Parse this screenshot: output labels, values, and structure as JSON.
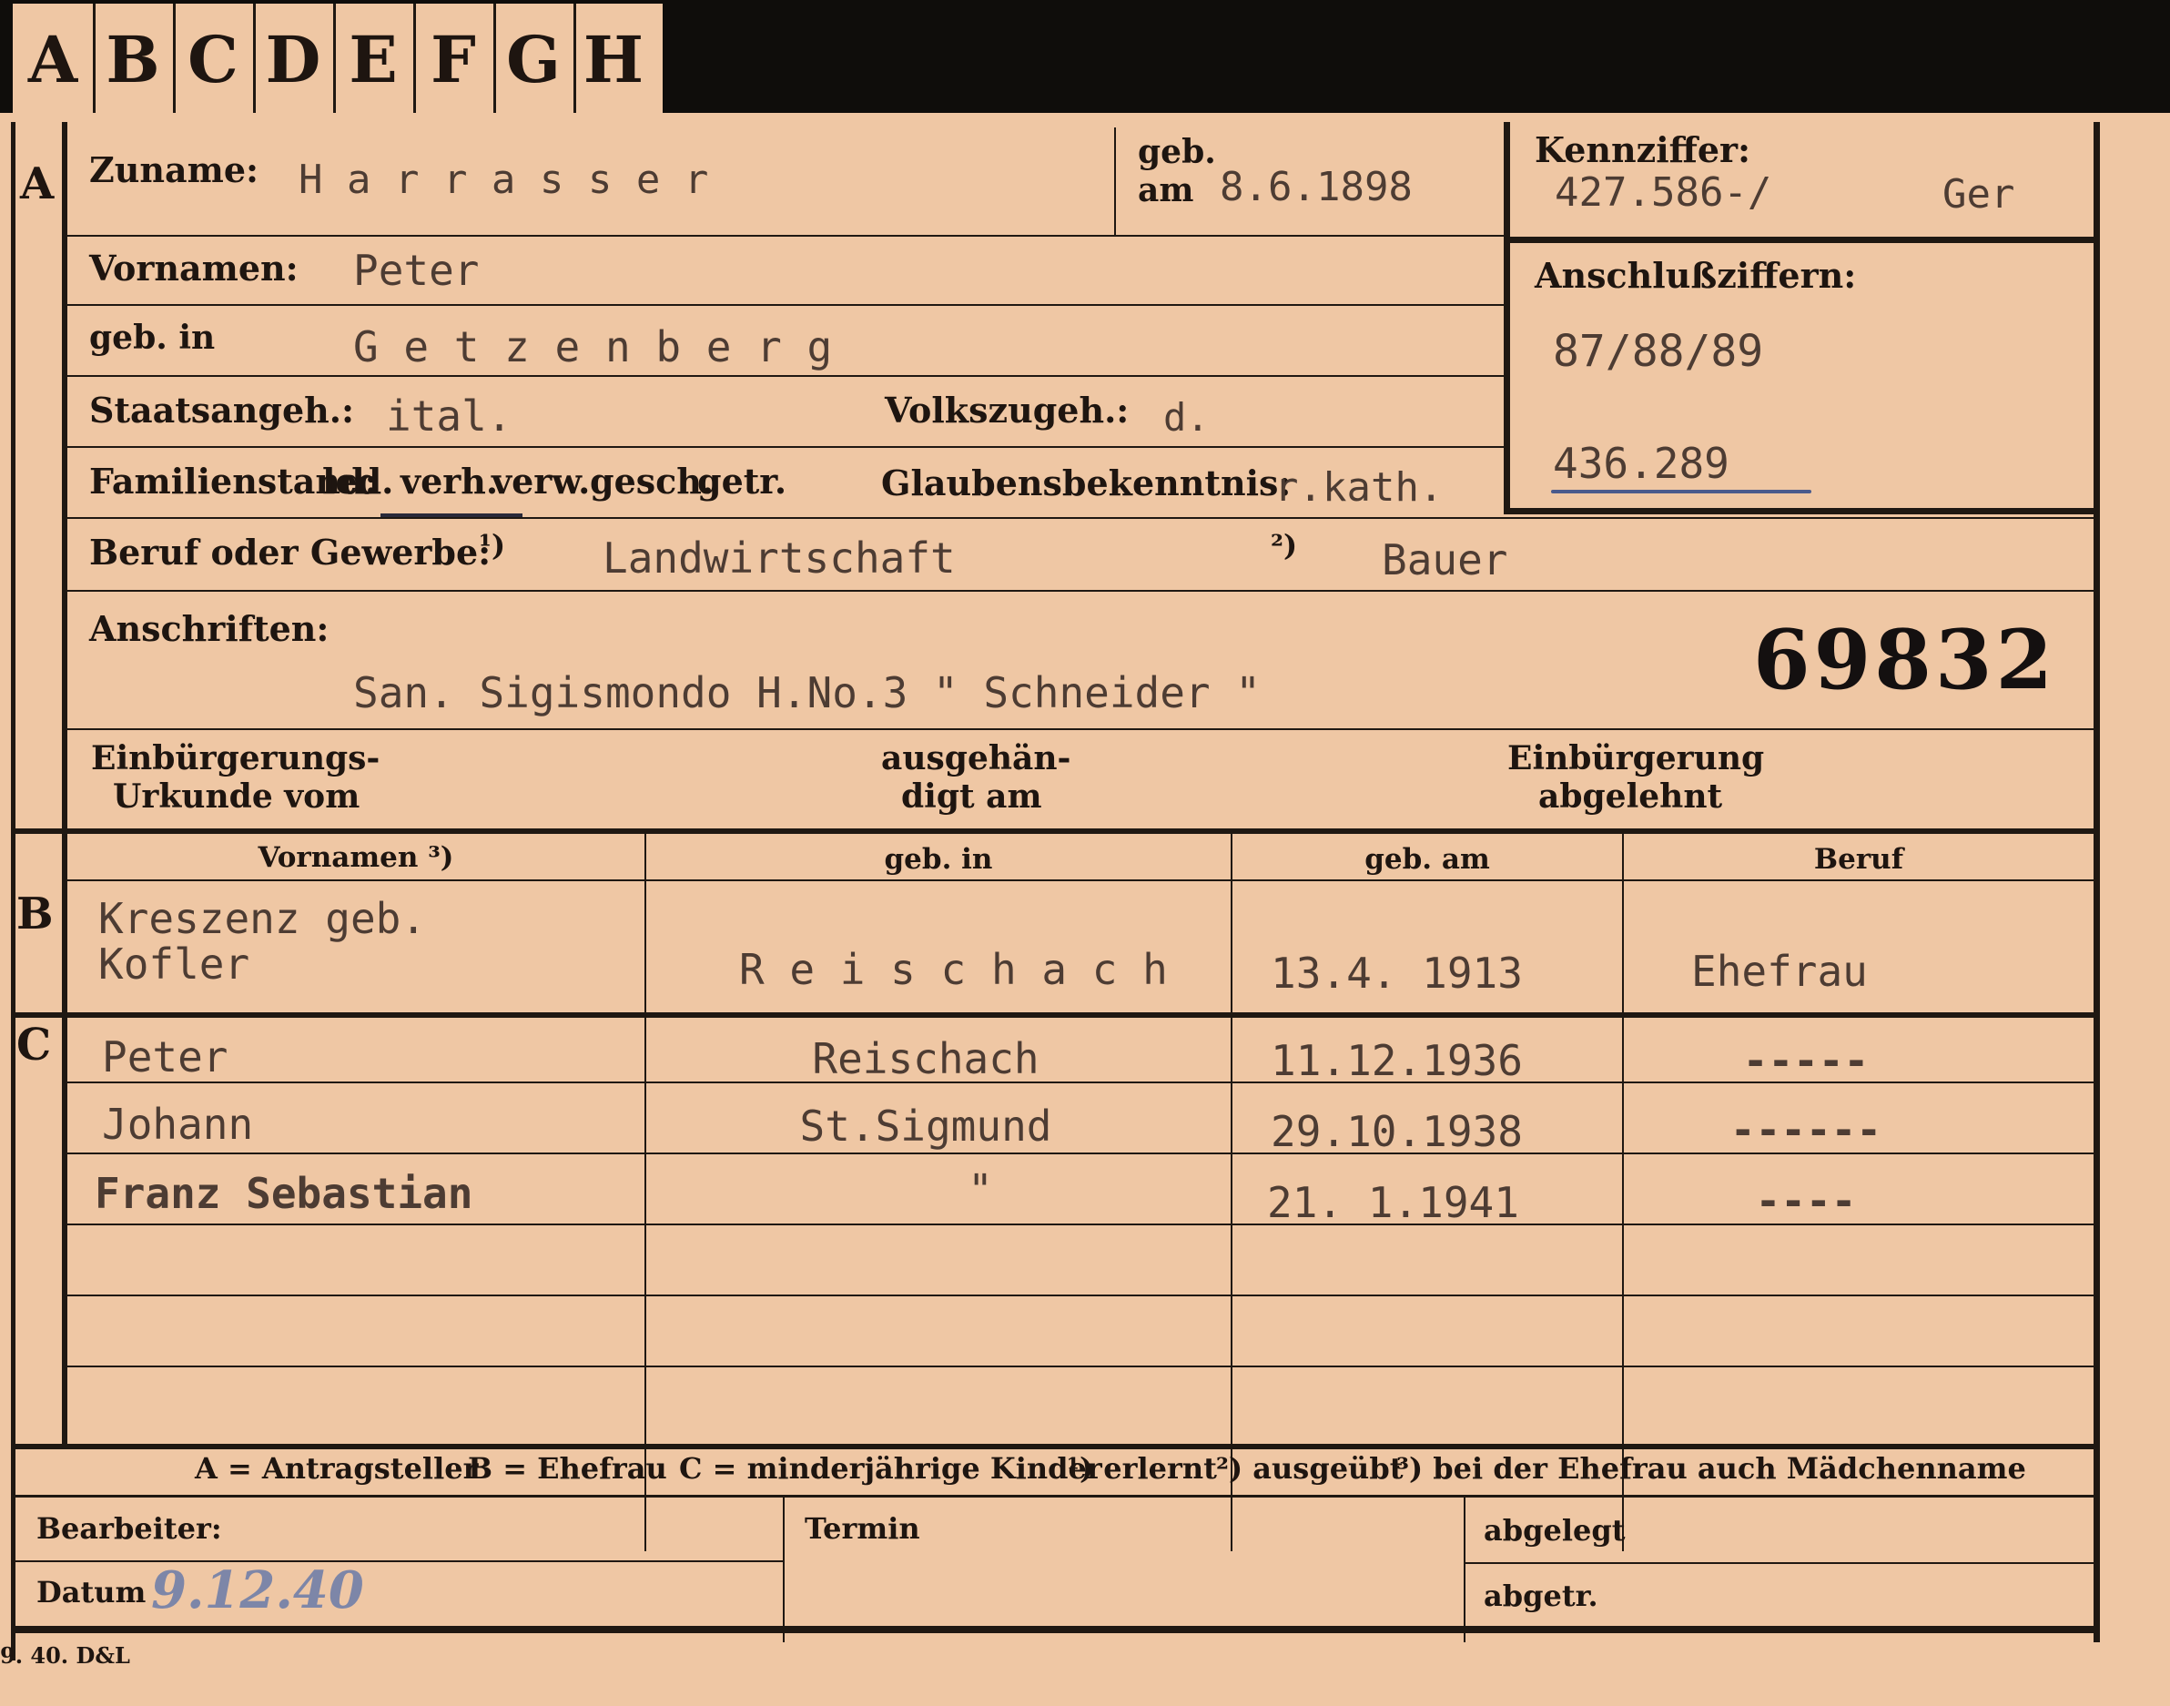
{
  "tabs": [
    "A",
    "B",
    "C",
    "D",
    "E",
    "F",
    "G",
    "H"
  ],
  "markers": {
    "a": "A",
    "b": "B",
    "c": "C"
  },
  "section_a": {
    "zuname_label": "Zuname:",
    "zuname_value": "H a r r a s s e r",
    "geb_label_line1": "geb.",
    "geb_label_line2": "am",
    "geb_value": "8.6.1898",
    "kennziffer_label": "Kennziffer:",
    "kennziffer_value": "427.586-/",
    "kennziffer_suffix": "Ger",
    "vornamen_label": "Vornamen:",
    "vornamen_value": "Peter",
    "gebin_label": "geb. in",
    "gebin_value": "G e t z e n b e r g",
    "anschluss_label": "Anschlußziffern:",
    "anschluss_value1": "87/88/89",
    "anschluss_value2": "436.289",
    "staat_label": "Staatsangeh.:",
    "staat_value": "ital.",
    "volk_label": "Volkszugeh.:",
    "volk_value": "d.",
    "familien_label": "Familienstand:",
    "familien_options": {
      "led": "led.",
      "verh": "verh.",
      "verw": "verw.",
      "gesch": "gesch.",
      "getr": "getr."
    },
    "glauben_label": "Glaubensbekenntnis:",
    "glauben_value": "r.kath.",
    "beruf_label": "Beruf oder Gewerbe:",
    "beruf_mark1": "¹)",
    "beruf_value1": "Landwirtschaft",
    "beruf_mark2": "²)",
    "beruf_value2": "Bauer",
    "anschriften_label": "Anschriften:",
    "anschriften_value": "San. Sigismondo H.No.3 \" Schneider \"",
    "stamp_number": "69832",
    "einb_label_line1": "Einbürgerungs-",
    "einb_label_line2": "Urkunde vom",
    "ausgeh_label_line1": "ausgehän-",
    "ausgeh_label_line2": "digt am",
    "abgelehnt_label_line1": "Einbürgerung",
    "abgelehnt_label_line2": "abgelehnt"
  },
  "table": {
    "headers": {
      "vornamen": "Vornamen ³)",
      "gebin": "geb. in",
      "gebam": "geb. am",
      "beruf": "Beruf"
    },
    "spouse": {
      "name_line1": "Kreszenz geb.",
      "name_line2": "Kofler",
      "gebin": "R e i s c h a c h",
      "gebam": "13.4. 1913",
      "beruf": "Ehefrau"
    },
    "children": [
      {
        "name": "Peter",
        "gebin": "Reischach",
        "gebam": "11.12.1936",
        "beruf": "-----"
      },
      {
        "name": "Johann",
        "gebin": "St.Sigmund",
        "gebam": "29.10.1938",
        "beruf": "------"
      },
      {
        "name": "Franz Sebastian",
        "gebin": "\"",
        "gebam": "21. 1.1941",
        "beruf": "----"
      }
    ]
  },
  "legend": {
    "a": "A = Antragsteller",
    "b": "B = Ehefrau",
    "c": "C = minderjährige Kinder",
    "n1": "¹) erlernt",
    "n2": "²) ausgeübt",
    "n3": "³) bei der Ehefrau auch Mädchenname"
  },
  "footer": {
    "bearbeiter_label": "Bearbeiter:",
    "datum_label": "Datum",
    "datum_value": "9.12.40",
    "termin_label": "Termin",
    "abgelegt_label": "abgelegt",
    "abgetr_label": "abgetr."
  },
  "print_mark": "9. 40. D&L"
}
